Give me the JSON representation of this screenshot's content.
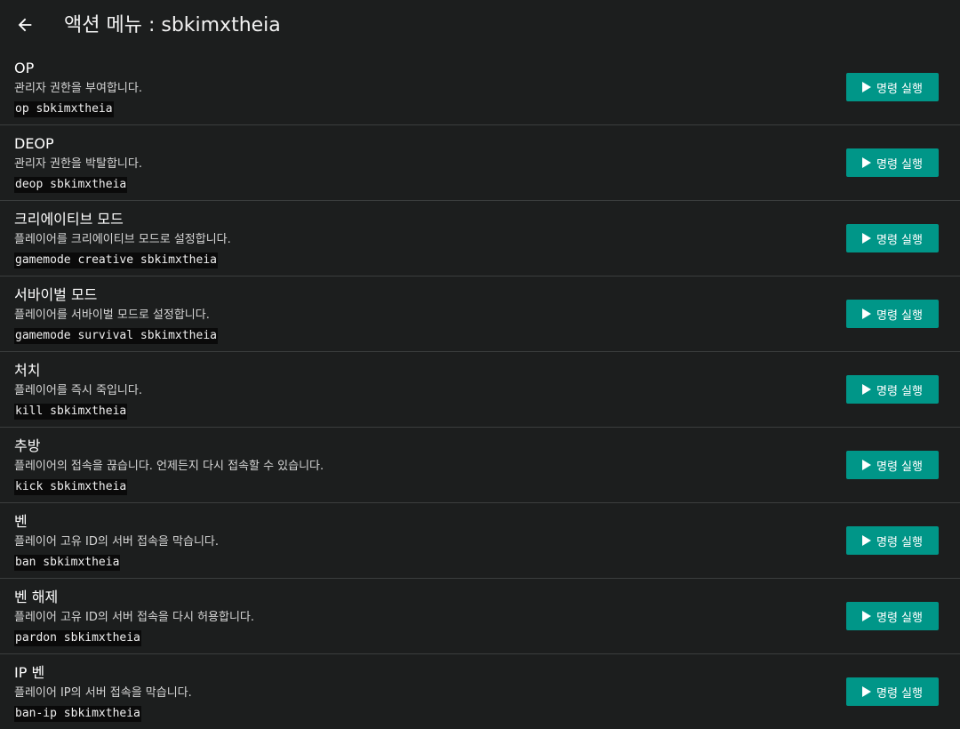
{
  "header": {
    "title": "액션 메뉴 : sbkimxtheia",
    "back_icon": "arrow-left-icon"
  },
  "colors": {
    "background": "#1c1e1e",
    "divider": "#3b3e3e",
    "button": "#009688",
    "command_bg": "#0a0a0a"
  },
  "button_label": "명령 실행",
  "button_icon": "play-icon",
  "actions": [
    {
      "title": "OP",
      "description": "관리자 권한을 부여합니다.",
      "command": "op sbkimxtheia"
    },
    {
      "title": "DEOP",
      "description": "관리자 권한을 박탈합니다.",
      "command": "deop sbkimxtheia"
    },
    {
      "title": "크리에이티브 모드",
      "description": "플레이어를 크리에이티브 모드로 설정합니다.",
      "command": "gamemode creative sbkimxtheia"
    },
    {
      "title": "서바이벌 모드",
      "description": "플레이어를 서바이벌 모드로 설정합니다.",
      "command": "gamemode survival sbkimxtheia"
    },
    {
      "title": "처치",
      "description": "플레이어를 즉시 죽입니다.",
      "command": "kill sbkimxtheia"
    },
    {
      "title": "추방",
      "description": "플레이어의 접속을 끊습니다. 언제든지 다시 접속할 수 있습니다.",
      "command": "kick sbkimxtheia"
    },
    {
      "title": "벤",
      "description": "플레이어 고유 ID의 서버 접속을 막습니다.",
      "command": "ban sbkimxtheia"
    },
    {
      "title": "벤 해제",
      "description": "플레이어 고유 ID의 서버 접속을 다시 허용합니다.",
      "command": "pardon sbkimxtheia"
    },
    {
      "title": "IP 벤",
      "description": "플레이어 IP의 서버 접속을 막습니다.",
      "command": "ban-ip sbkimxtheia"
    }
  ]
}
